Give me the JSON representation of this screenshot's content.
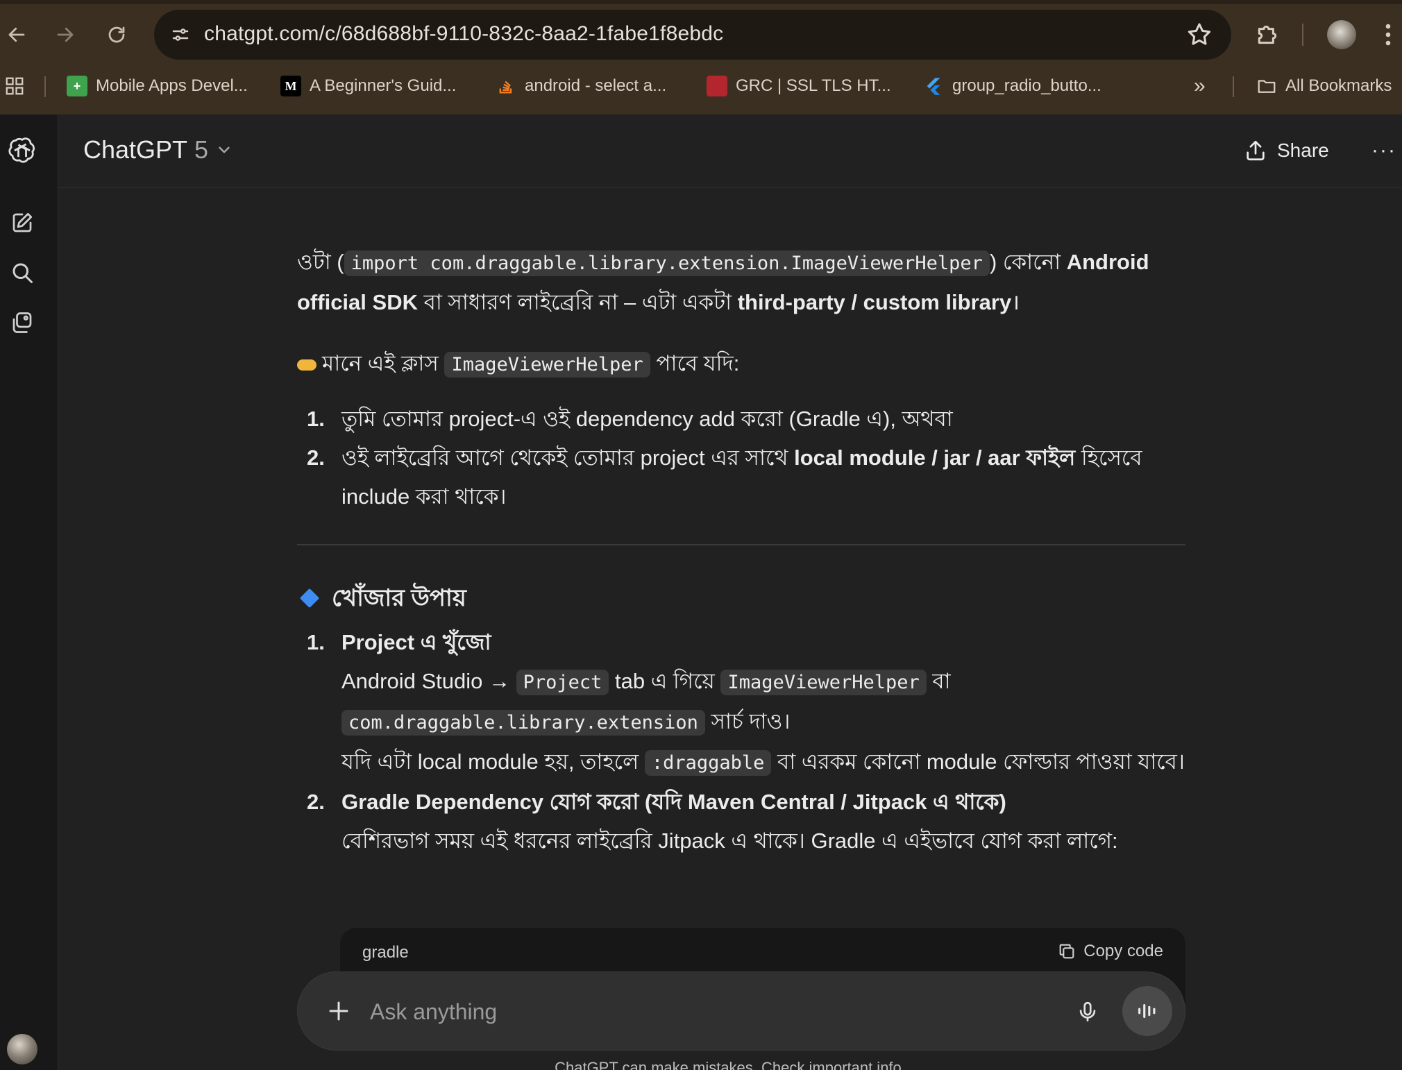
{
  "browser": {
    "url": "chatgpt.com/c/68d688bf-9110-832c-8aa2-1fabe1f8ebdc",
    "bookmarks": [
      {
        "label": "Mobile Apps Devel...",
        "icon": "green-plus-icon",
        "color": "#3fa34d"
      },
      {
        "label": "A Beginner's Guid...",
        "icon": "medium-logo-icon",
        "color": "#000000"
      },
      {
        "label": "android - select a...",
        "icon": "stackoverflow-icon",
        "color": "#f48024"
      },
      {
        "label": "GRC | SSL TLS HT...",
        "icon": "grc-icon",
        "color": "#b3262e"
      },
      {
        "label": "group_radio_butto...",
        "icon": "flutter-icon",
        "color": "#42a5f5"
      }
    ],
    "more_bookmarks": "»",
    "all_bookmarks": "All Bookmarks"
  },
  "header": {
    "model_name": "ChatGPT",
    "model_version": "5",
    "share_label": "Share",
    "more_label": "···"
  },
  "message": {
    "p1_pre": "ওটা (",
    "p1_code": "import com.draggable.library.extension.ImageViewerHelper",
    "p1_mid": ") কোনো ",
    "p1_bold1": "Android official SDK",
    "p1_mid2": " বা সাধারণ লাইব্রেরি না – এটা একটা ",
    "p1_bold2": "third-party / custom library",
    "p1_end": "।",
    "p2_pre": "মানে এই ক্লাস ",
    "p2_code": "ImageViewerHelper",
    "p2_end": " পাবে যদি:",
    "list1": [
      {
        "num": "1.",
        "text": "তুমি তোমার project-এ ওই dependency add করো (Gradle এ), অথবা"
      },
      {
        "num": "2.",
        "pre": "ওই লাইব্রেরি আগে থেকেই তোমার project এর সাথে ",
        "bold": "local module / jar / aar ফাইল",
        "post": " হিসেবে include করা থাকে।"
      }
    ],
    "section_title": "খোঁজার উপায়",
    "step1": {
      "num": "1.",
      "title": "Project এ খুঁজো",
      "line1_pre": "Android Studio → ",
      "line1_code1": "Project",
      "line1_mid": " tab এ গিয়ে ",
      "line1_code2": "ImageViewerHelper",
      "line1_end": " বা",
      "line2_code": "com.draggable.library.extension",
      "line2_end": " সার্চ দাও।",
      "line3_pre": "যদি এটা local module হয়, তাহলে ",
      "line3_code": ":draggable",
      "line3_end": " বা এরকম কোনো module ফোল্ডার পাওয়া যাবে।"
    },
    "step2": {
      "num": "2.",
      "title": "Gradle Dependency যোগ করো (যদি Maven Central / Jitpack এ থাকে)",
      "text": "বেশিরভাগ সময় এই ধরনের লাইব্রেরি Jitpack এ থাকে। Gradle এ এইভাবে যোগ করা লাগে:"
    },
    "code_lang": "gradle",
    "copy_label": "Copy code"
  },
  "composer": {
    "placeholder": "Ask anything"
  },
  "footer": "ChatGPT can make mistakes. Check important info."
}
